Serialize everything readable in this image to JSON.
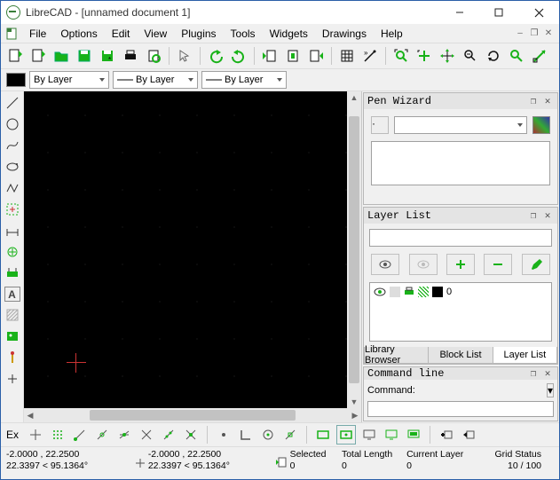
{
  "title": "LibreCAD - [unnamed document 1]",
  "menus": [
    "File",
    "Options",
    "Edit",
    "View",
    "Plugins",
    "Tools",
    "Widgets",
    "Drawings",
    "Help"
  ],
  "pen": {
    "bylayer1": "By Layer",
    "bylayer2": "By Layer",
    "bylayer3": "By Layer"
  },
  "panels": {
    "penwizard": {
      "title": "Pen Wizard"
    },
    "layerlist": {
      "title": "Layer List",
      "layer0": "0",
      "tabs": [
        "Library Browser",
        "Block List",
        "Layer List"
      ]
    },
    "cmd": {
      "title": "Command line",
      "label": "Command:",
      "clearbtn": "▾"
    }
  },
  "bottombar": {
    "ex": "Ex"
  },
  "status": {
    "coords1_a": "-2.0000 , 22.2500",
    "coords1_b": "22.3397 < 95.1364°",
    "coords2_a": "-2.0000 , 22.2500",
    "coords2_b": "22.3397 < 95.1364°",
    "sel_l1": "Selected",
    "sel_l2": "0",
    "tot_l1": "Total Length",
    "tot_l2": "0",
    "cur_l1": "Current Layer",
    "cur_l2": "0",
    "grid_l1": "Grid Status",
    "grid_l2": "10 / 100"
  }
}
